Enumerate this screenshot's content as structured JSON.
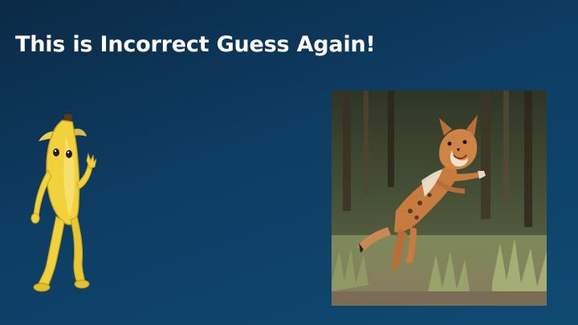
{
  "slide": {
    "title": "This is Incorrect Guess Again!"
  },
  "images": {
    "left": {
      "icon": "banana-character"
    },
    "right": {
      "icon": "wild-cat-photo"
    }
  },
  "colors": {
    "background_top": "#0b2a46",
    "background_bottom": "#0f4a72",
    "title_text": "#ffffff",
    "banana_yellow": "#f2d23c"
  }
}
